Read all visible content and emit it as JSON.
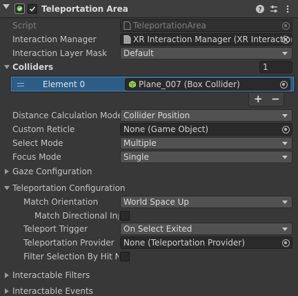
{
  "component": {
    "title": "Teleportation Area",
    "icon": "teleport-component-icon",
    "enabled": true,
    "tools": [
      "help-icon",
      "presets-icon",
      "more-options-icon"
    ]
  },
  "fields": {
    "script": {
      "label": "Script",
      "value": "TeleportationArea"
    },
    "interaction_manager": {
      "label": "Interaction Manager",
      "value": "XR Interaction Manager (XR Interaction"
    },
    "interaction_layer_mask": {
      "label": "Interaction Layer Mask",
      "value": "Default"
    },
    "colliders": {
      "label": "Colliders",
      "count": "1",
      "element_label": "Element 0",
      "element_value": "Plane_007 (Box Collider)",
      "add": "+",
      "remove": "−"
    },
    "distance_calc": {
      "label": "Distance Calculation Mode",
      "value": "Collider Position"
    },
    "custom_reticle": {
      "label": "Custom Reticle",
      "value": "None (Game Object)"
    },
    "select_mode": {
      "label": "Select Mode",
      "value": "Multiple"
    },
    "focus_mode": {
      "label": "Focus Mode",
      "value": "Single"
    },
    "gaze_config": {
      "label": "Gaze Configuration"
    },
    "teleport_config": {
      "label": "Teleportation Configuration"
    },
    "match_orientation": {
      "label": "Match Orientation",
      "value": "World Space Up"
    },
    "match_directional": {
      "label": "Match Directional Input",
      "checked": false
    },
    "teleport_trigger": {
      "label": "Teleport Trigger",
      "value": "On Select Exited"
    },
    "teleport_provider": {
      "label": "Teleportation Provider",
      "value": "None (Teleportation Provider)"
    },
    "filter_selection": {
      "label": "Filter Selection By Hit Normal",
      "checked": false
    },
    "interactable_filters": {
      "label": "Interactable Filters"
    },
    "interactable_events": {
      "label": "Interactable Events"
    }
  },
  "colors": {
    "background": "#383838",
    "selection": "#2c5d87",
    "selection_border": "#3a79bb",
    "collider_icon": "#8fd14f"
  }
}
